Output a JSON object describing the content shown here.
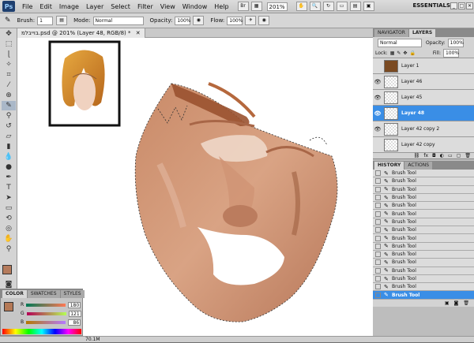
{
  "menubar": {
    "logo": "Ps",
    "items": [
      "File",
      "Edit",
      "Image",
      "Layer",
      "Select",
      "Filter",
      "View",
      "Window",
      "Help"
    ],
    "zoom": "201%",
    "workspace": "ESSENTIALS",
    "minimize": "_",
    "maximize": "□",
    "close": "✕"
  },
  "options": {
    "brush_label": "Brush:",
    "brush_size": "1",
    "mode_label": "Mode:",
    "mode_value": "Normal",
    "opacity_label": "Opacity:",
    "opacity_value": "100%",
    "flow_label": "Flow:",
    "flow_value": "100%"
  },
  "document": {
    "tab_title": "בוייבלמ.psd @ 201% (Layer 48, RGB/8) *"
  },
  "status": {
    "doc_size": "70.1M"
  },
  "panels": {
    "layers": {
      "tabs": [
        "NAVIGATOR",
        "LAYERS"
      ],
      "blend_mode": "Normal",
      "opacity_label": "Opacity:",
      "opacity_value": "100%",
      "lock_label": "Lock:",
      "fill_label": "Fill:",
      "fill_value": "100%",
      "rows": [
        {
          "name": "Layer 1",
          "visible": false,
          "selected": false
        },
        {
          "name": "Layer 46",
          "visible": true,
          "selected": false
        },
        {
          "name": "Layer 45",
          "visible": true,
          "selected": false
        },
        {
          "name": "Layer 48",
          "visible": true,
          "selected": true
        },
        {
          "name": "Layer 42 copy 2",
          "visible": true,
          "selected": false
        },
        {
          "name": "Layer 42 copy",
          "visible": false,
          "selected": false
        }
      ]
    },
    "history": {
      "tabs": [
        "HISTORY",
        "ACTIONS"
      ],
      "items": [
        "Brush Tool",
        "Brush Tool",
        "Brush Tool",
        "Brush Tool",
        "Brush Tool",
        "Brush Tool",
        "Brush Tool",
        "Brush Tool",
        "Brush Tool",
        "Brush Tool",
        "Brush Tool",
        "Brush Tool",
        "Brush Tool",
        "Brush Tool",
        "Brush Tool",
        "Brush Tool"
      ],
      "selected_index": 15
    },
    "color": {
      "tabs": [
        "COLOR",
        "SWATCHES",
        "STYLES"
      ],
      "r_label": "R",
      "g_label": "G",
      "b_label": "B",
      "r": "180",
      "g": "121",
      "b": "86",
      "fg": "#b57956"
    }
  }
}
